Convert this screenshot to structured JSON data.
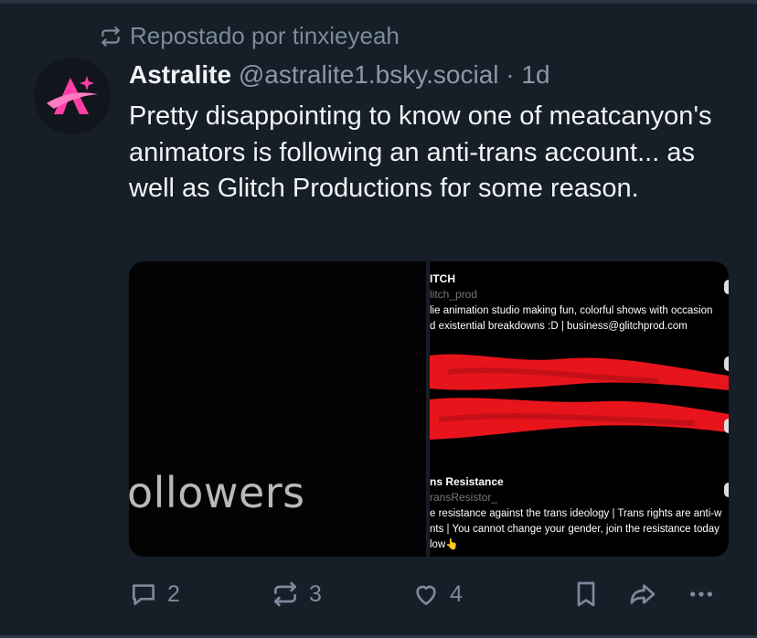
{
  "repost": {
    "text": "Repostado por tinxieyeah"
  },
  "post": {
    "author_name": "Astralite",
    "handle": "@astralite1.bsky.social",
    "separator": "·",
    "time": "1d",
    "text": "Pretty disappointing to know one of meatcanyon's animators is following an anti-trans account... as well as Glitch Productions for some reason."
  },
  "media": {
    "left_image_text": "ollowers",
    "right_image": {
      "account1": {
        "name": "ITCH",
        "handle": "litch_prod",
        "bio_line1": "lie animation studio making fun, colorful shows with occasion",
        "bio_line2": "d existential breakdowns :D | business@glitchprod.com"
      },
      "account2": {
        "name": "ns Resistance",
        "handle": "ransResistor_",
        "bio_line1": "e resistance against the trans ideology | Trans rights are anti-w",
        "bio_line2": "nts | You cannot change your gender, join the resistance today",
        "bio_line3": "low👆"
      }
    },
    "scribble_color": "#e8141c"
  },
  "actions": {
    "reply_count": "2",
    "repost_count": "3",
    "like_count": "4"
  },
  "colors": {
    "background": "#161e27",
    "muted_text": "#7b8a9c",
    "avatar_accent": "#ff3fa4"
  }
}
